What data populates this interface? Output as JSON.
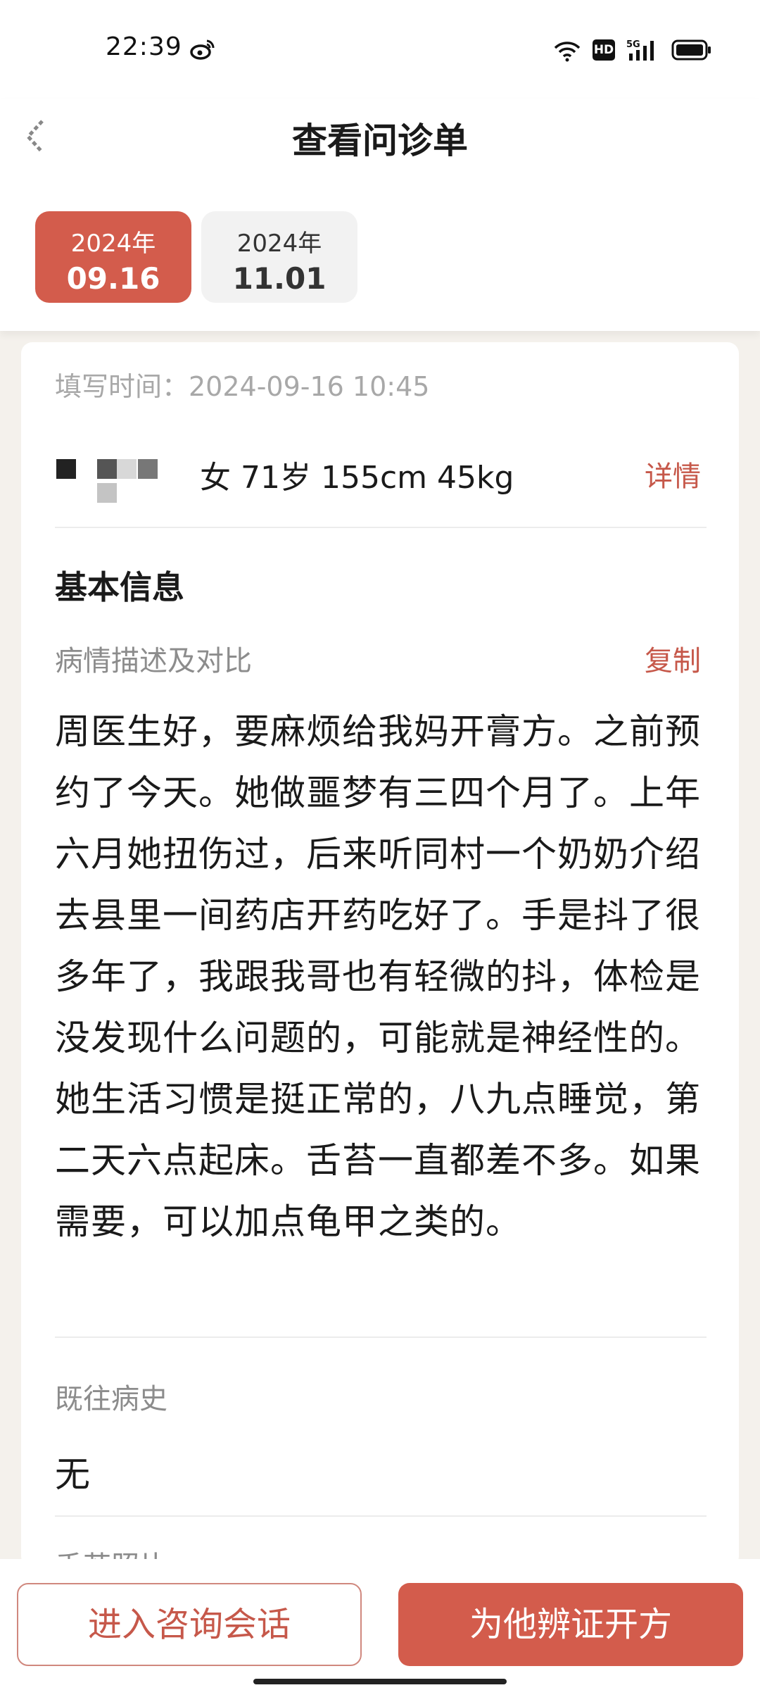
{
  "status_bar": {
    "time": "22:39",
    "icons": [
      "weibo-icon",
      "wifi-icon",
      "hd-icon",
      "signal-icon",
      "battery-icon"
    ],
    "hd_label": "HD",
    "network_label": "5G"
  },
  "header": {
    "title": "查看问诊单",
    "back_icon": "back-arrow-icon"
  },
  "date_tabs": [
    {
      "year": "2024年",
      "day": "09.16",
      "active": true
    },
    {
      "year": "2024年",
      "day": "11.01",
      "active": false
    }
  ],
  "record": {
    "fill_time": "填写时间：2024-09-16 10:45",
    "patient_info": "女 71岁 155cm 45kg",
    "detail_label": "详情",
    "section_title": "基本信息",
    "description_label": "病情描述及对比",
    "copy_label": "复制",
    "description": "周医生好，要麻烦给我妈开膏方。之前预约了今天。她做噩梦有三四个月了。上年六月她扭伤过，后来听同村一个奶奶介绍去县里一间药店开药吃好了。手是抖了很多年了，我跟我哥也有轻微的抖，体检是没发现什么问题的，可能就是神经性的。她生活习惯是挺正常的，八九点睡觉，第二天六点起床。舌苔一直都差不多。如果需要，可以加点龟甲之类的。",
    "history_label": "既往病史",
    "history_value": "无",
    "tongue_label": "舌苔照片"
  },
  "actions": {
    "consult_label": "进入咨询会话",
    "prescribe_label": "为他辨证开方"
  },
  "colors": {
    "accent": "#d35c4c",
    "accent_text": "#c6584a",
    "background": "#f4f1ec"
  }
}
